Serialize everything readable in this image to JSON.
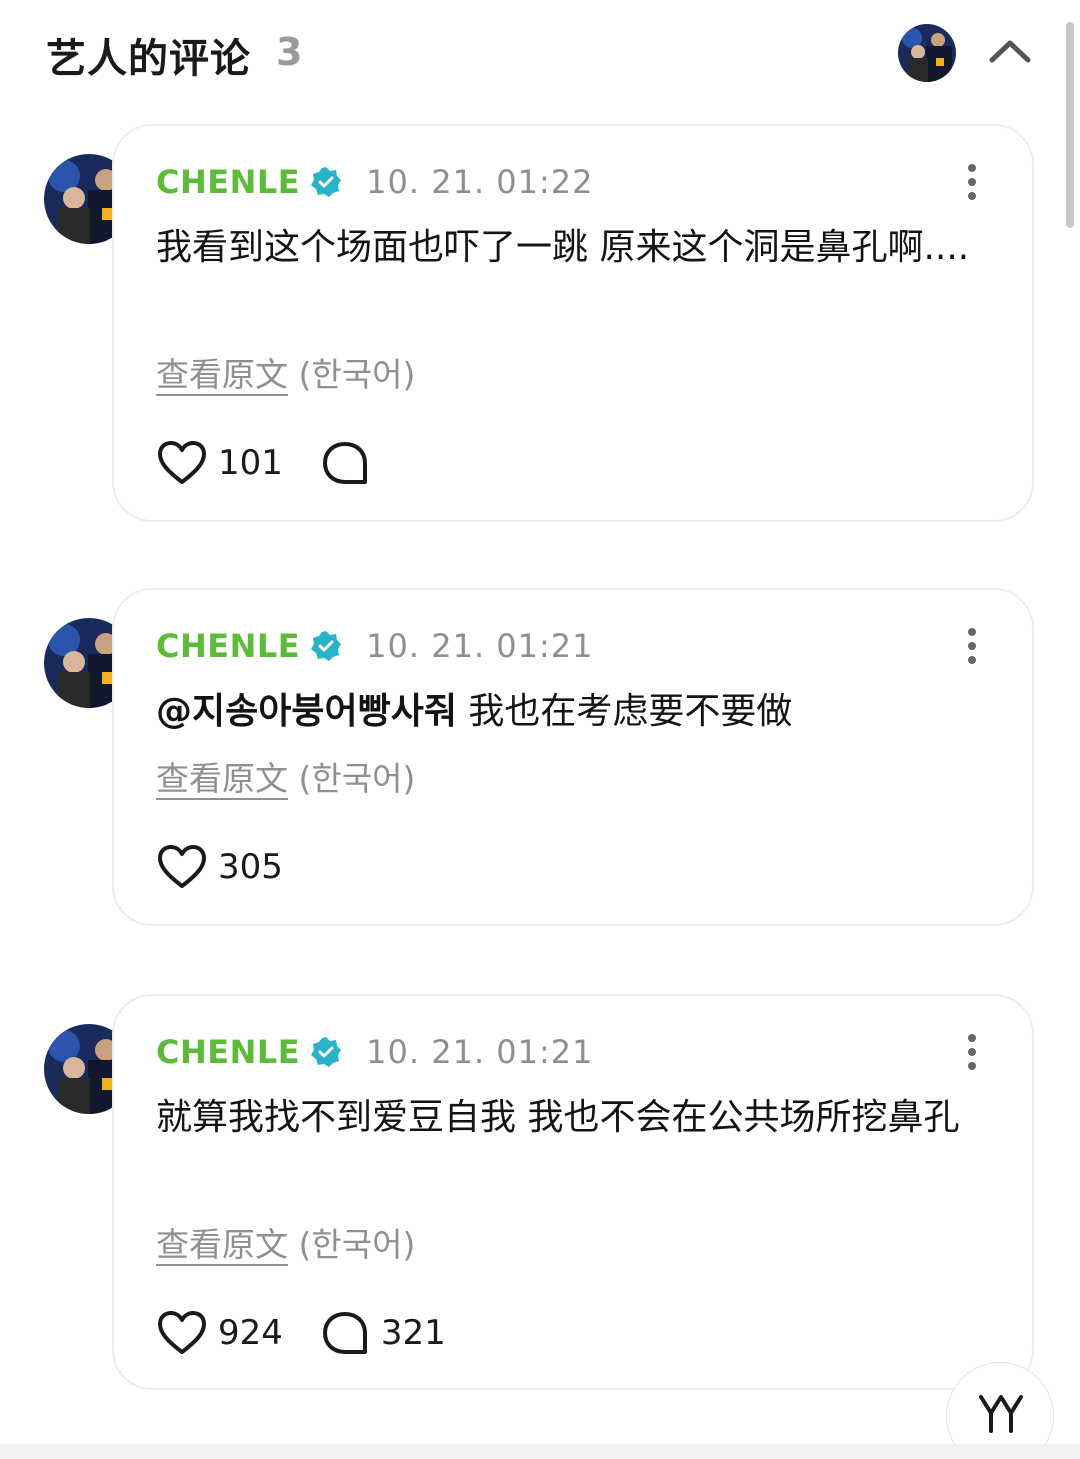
{
  "header": {
    "title": "艺人的评论",
    "count": "3",
    "avatar_icon": "artist-avatar",
    "collapse_icon": "chevron-up-icon"
  },
  "colors": {
    "username": "#5dbb3b",
    "verified": "#28b3c9",
    "muted": "#909090",
    "border": "#ececec"
  },
  "comments": [
    {
      "username": "CHENLE",
      "timestamp": "10. 21. 01:22",
      "text": "我看到这个场面也吓了一跳 原来这个洞是鼻孔啊....",
      "mention": "",
      "translate_link": "查看原文",
      "translate_lang": "(한국어)",
      "likes": "101",
      "replies": ""
    },
    {
      "username": "CHENLE",
      "timestamp": "10. 21. 01:21",
      "text": " 我也在考虑要不要做",
      "mention": "@지송아붕어빵사줘",
      "translate_link": "查看原文",
      "translate_lang": "(한국어)",
      "likes": "305",
      "replies": ""
    },
    {
      "username": "CHENLE",
      "timestamp": "10. 21. 01:21",
      "text": "就算我找不到爱豆自我 我也不会在公共场所挖鼻孔",
      "mention": "",
      "translate_link": "查看原文",
      "translate_lang": "(한국어)",
      "likes": "924",
      "replies": "321"
    }
  ],
  "fab_icon": "weverse-logo-icon"
}
